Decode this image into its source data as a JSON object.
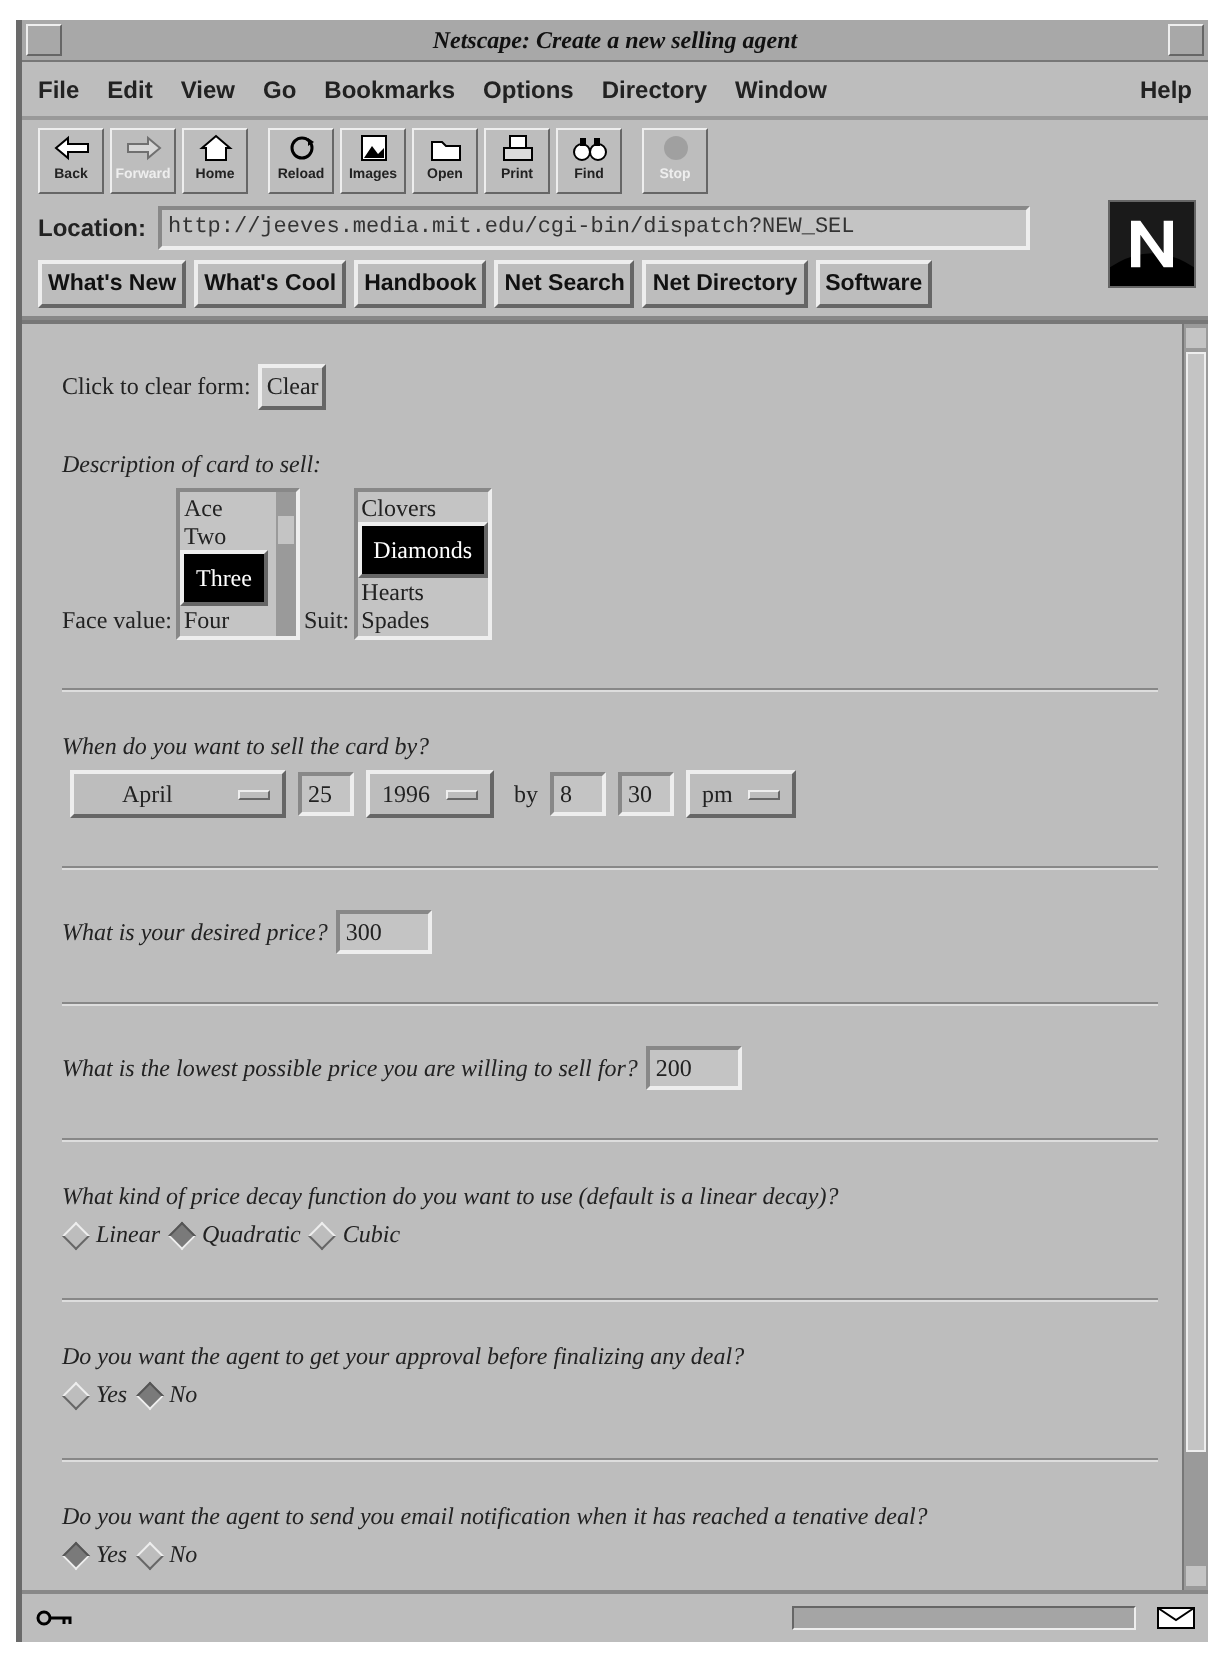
{
  "window": {
    "title": "Netscape: Create a new selling agent"
  },
  "menu": [
    {
      "label": "File"
    },
    {
      "label": "Edit"
    },
    {
      "label": "View"
    },
    {
      "label": "Go"
    },
    {
      "label": "Bookmarks"
    },
    {
      "label": "Options"
    },
    {
      "label": "Directory"
    },
    {
      "label": "Window"
    }
  ],
  "help_menu": {
    "label": "Help"
  },
  "toolbar_groups": [
    [
      {
        "label": "Back",
        "kind": "back",
        "disabled": false
      },
      {
        "label": "Forward",
        "kind": "forward",
        "disabled": true
      },
      {
        "label": "Home",
        "kind": "home",
        "disabled": false
      }
    ],
    [
      {
        "label": "Reload",
        "kind": "reload",
        "disabled": false
      },
      {
        "label": "Images",
        "kind": "images",
        "disabled": false
      },
      {
        "label": "Open",
        "kind": "open",
        "disabled": false
      },
      {
        "label": "Print",
        "kind": "print",
        "disabled": false
      },
      {
        "label": "Find",
        "kind": "find",
        "disabled": false
      }
    ],
    [
      {
        "label": "Stop",
        "kind": "stop",
        "disabled": true
      }
    ]
  ],
  "location": {
    "label": "Location:",
    "value": "http://jeeves.media.mit.edu/cgi-bin/dispatch?NEW_SEL"
  },
  "directory_buttons": [
    {
      "label": "What's New"
    },
    {
      "label": "What's Cool"
    },
    {
      "label": "Handbook"
    },
    {
      "label": "Net Search"
    },
    {
      "label": "Net Directory"
    },
    {
      "label": "Software"
    }
  ],
  "form": {
    "clear": {
      "label": "Click to clear form:",
      "button": "Clear"
    },
    "card": {
      "heading": "Description of card to sell:",
      "face_label": "Face value:",
      "face_options": [
        {
          "label": "Ace",
          "selected": false
        },
        {
          "label": "Two",
          "selected": false
        },
        {
          "label": "Three",
          "selected": true
        },
        {
          "label": "Four",
          "selected": false
        }
      ],
      "suit_label": "Suit:",
      "suit_options": [
        {
          "label": "Clovers",
          "selected": false
        },
        {
          "label": "Diamonds",
          "selected": true
        },
        {
          "label": "Hearts",
          "selected": false
        },
        {
          "label": "Spades",
          "selected": false
        }
      ]
    },
    "date": {
      "question": "When do you want to sell the card by?",
      "month": "April",
      "day": "25",
      "year": "1996",
      "by_label": "by",
      "hour": "8",
      "minute": "30",
      "ampm": "pm"
    },
    "desired_price": {
      "question": "What is your desired price?",
      "value": "300"
    },
    "lowest_price": {
      "question": "What is the lowest possible price you are willing to sell for?",
      "value": "200"
    },
    "radio_groups": [
      {
        "question": "What kind of price decay function do you want to use (default is a linear decay)?",
        "options": [
          {
            "label": "Linear",
            "selected": false
          },
          {
            "label": "Quadratic",
            "selected": true
          },
          {
            "label": "Cubic",
            "selected": false
          }
        ]
      },
      {
        "question": "Do you want the agent to get your approval before finalizing any deal?",
        "options": [
          {
            "label": "Yes",
            "selected": false
          },
          {
            "label": "No",
            "selected": true
          }
        ]
      },
      {
        "question": "Do you want the agent to send you email notification when it has reached a tenative deal?",
        "options": [
          {
            "label": "Yes",
            "selected": true
          },
          {
            "label": "No",
            "selected": false
          }
        ]
      }
    ]
  }
}
